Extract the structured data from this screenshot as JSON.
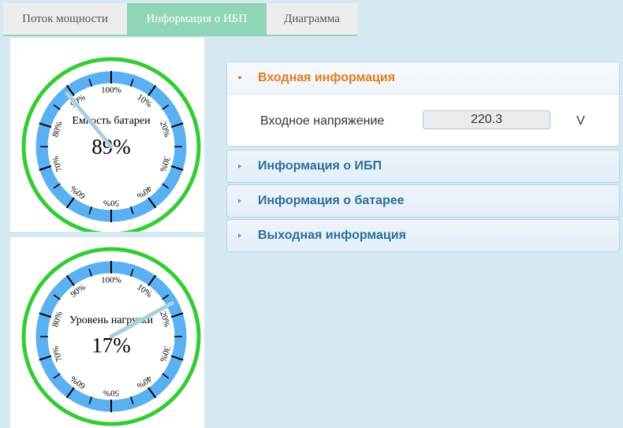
{
  "tabs": [
    {
      "label": "Поток мощности",
      "active": false
    },
    {
      "label": "Информация о ИБП",
      "active": true
    },
    {
      "label": "Диаграмма",
      "active": false
    }
  ],
  "gauges": [
    {
      "label": "Емкость батареи",
      "value": 89,
      "value_text": "89%"
    },
    {
      "label": "Уровень нагрузки",
      "value": 17,
      "value_text": "17%"
    }
  ],
  "gauge_ticks": [
    "100%",
    "10%",
    "20%",
    "30%",
    "40%",
    "50%",
    "60%",
    "70%",
    "80%",
    "90%"
  ],
  "colors": {
    "ring": "#33cc33",
    "band": "#5ab0f0",
    "needle": "#a8d0df",
    "tab_active": "#8fd6b8",
    "accordion_open_title": "#e07c1c",
    "accordion_title": "#2d6f9f"
  },
  "accordion": [
    {
      "title": "Входная информация",
      "open": true,
      "fields": [
        {
          "label": "Входное напряжение",
          "value": "220.3",
          "unit": "V"
        }
      ]
    },
    {
      "title": "Информация о ИБП",
      "open": false
    },
    {
      "title": "Информация о батарее",
      "open": false
    },
    {
      "title": "Выходная информация",
      "open": false
    }
  ]
}
